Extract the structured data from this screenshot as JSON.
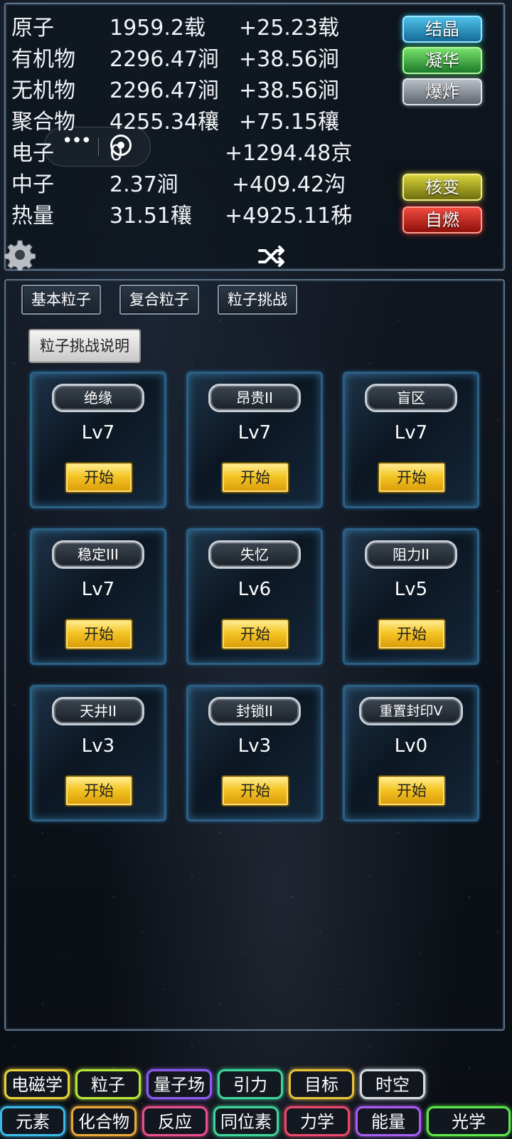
{
  "stats": [
    {
      "name": "原子",
      "amount": "1959.2载",
      "rate": "+25.23载"
    },
    {
      "name": "有机物",
      "amount": "2296.47涧",
      "rate": "+38.56涧"
    },
    {
      "name": "无机物",
      "amount": "2296.47涧",
      "rate": "+38.56涧"
    },
    {
      "name": "聚合物",
      "amount": "4255.34穰",
      "rate": "+75.15穰"
    },
    {
      "name": "电子",
      "amount": "0",
      "rate": "+1294.48京"
    },
    {
      "name": "中子",
      "amount": "2.37涧",
      "rate": "+409.42沟"
    },
    {
      "name": "热量",
      "amount": "31.51穰",
      "rate": "+4925.11秭"
    }
  ],
  "actions": {
    "crystallize": "结晶",
    "condense": "凝华",
    "explode": "爆炸",
    "fission": "核变",
    "ignite": "自燃"
  },
  "tabs": [
    "基本粒子",
    "复合粒子",
    "粒子挑战"
  ],
  "challenge_info_label": "粒子挑战说明",
  "start_label": "开始",
  "challenges": [
    {
      "name": "绝缘",
      "level": "Lv7"
    },
    {
      "name": "昂贵II",
      "level": "Lv7"
    },
    {
      "name": "盲区",
      "level": "Lv7"
    },
    {
      "name": "稳定III",
      "level": "Lv7"
    },
    {
      "name": "失忆",
      "level": "Lv6"
    },
    {
      "name": "阻力II",
      "level": "Lv5"
    },
    {
      "name": "天井II",
      "level": "Lv3"
    },
    {
      "name": "封锁II",
      "level": "Lv3"
    },
    {
      "name": "重置封印V",
      "level": "Lv0"
    }
  ],
  "nav_row1": [
    {
      "label": "电磁学",
      "color": "#e8d23a"
    },
    {
      "label": "粒子",
      "color": "#b9e83a"
    },
    {
      "label": "量子场",
      "color": "#8c5cf0"
    },
    {
      "label": "引力",
      "color": "#3fd49a"
    },
    {
      "label": "目标",
      "color": "#e8c23a"
    },
    {
      "label": "时空",
      "color": "#d8dde3"
    }
  ],
  "nav_row2": [
    {
      "label": "元素",
      "color": "#3ab8e8"
    },
    {
      "label": "化合物",
      "color": "#e8a83a"
    },
    {
      "label": "反应",
      "color": "#e8508c"
    },
    {
      "label": "同位素",
      "color": "#3fd49a"
    },
    {
      "label": "力学",
      "color": "#e84a6a"
    },
    {
      "label": "能量",
      "color": "#a85cf0"
    },
    {
      "label": "光学",
      "color": "#5ce84a"
    }
  ]
}
